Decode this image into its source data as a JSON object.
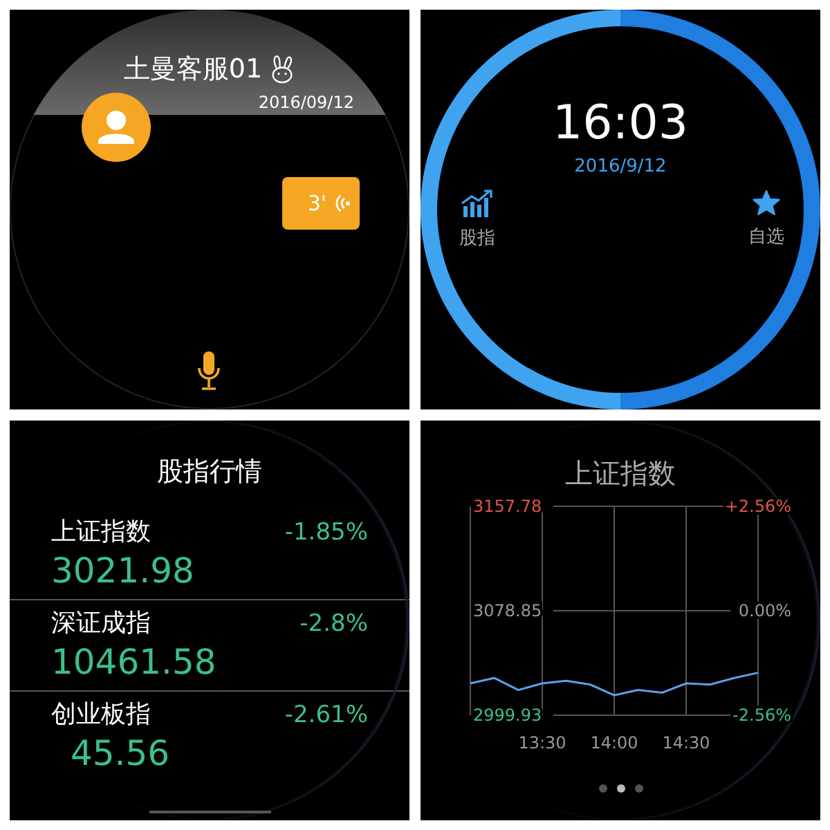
{
  "chat_screen": {
    "contact": "土曼客服01",
    "date": "2016/09/12",
    "voice_message": {
      "duration": "3'"
    }
  },
  "home_screen": {
    "time": "16:03",
    "date": "2016/9/12",
    "shortcuts": [
      {
        "kind": "indices",
        "label": "股指"
      },
      {
        "kind": "watchlist",
        "label": "自选"
      }
    ]
  },
  "index_list": {
    "title": "股指行情",
    "rows": [
      {
        "name": "上证指数",
        "change": "-1.85%",
        "value": "3021.98"
      },
      {
        "name": "深证成指",
        "change": "-2.8%",
        "value": "10461.58"
      },
      {
        "name": "创业板指",
        "change": "-2.61%",
        "value": "45.56"
      }
    ]
  },
  "index_chart": {
    "title": "上证指数",
    "right_labels": [
      {
        "text": "+2.56%",
        "color": "#e0564b"
      },
      {
        "text": "0.00%",
        "color": "#9a9a9a"
      },
      {
        "text": "-2.56%",
        "color": "#3cc08a"
      }
    ],
    "chart_data": {
      "type": "line",
      "categories": [
        null,
        null,
        null,
        "13:30",
        null,
        null,
        "14:00",
        null,
        null,
        "14:30",
        null,
        null,
        null
      ],
      "grid": true,
      "series": [
        {
          "color": "#5aa0e6",
          "values": [
            3024,
            3028,
            3019,
            3024,
            3026,
            3023,
            3015,
            3019,
            3017,
            3024,
            3023,
            3028,
            3032
          ]
        }
      ],
      "ylim": [
        2999.93,
        3157.78
      ],
      "yticks": [
        {
          "value": 3157.78,
          "label": "3157.78"
        },
        {
          "value": 3078.85,
          "label": "3078.85"
        },
        {
          "value": 2999.93,
          "label": "2999.93"
        }
      ]
    },
    "pages": [
      {
        "selected": false
      },
      {
        "selected": true
      },
      {
        "selected": false
      }
    ]
  }
}
